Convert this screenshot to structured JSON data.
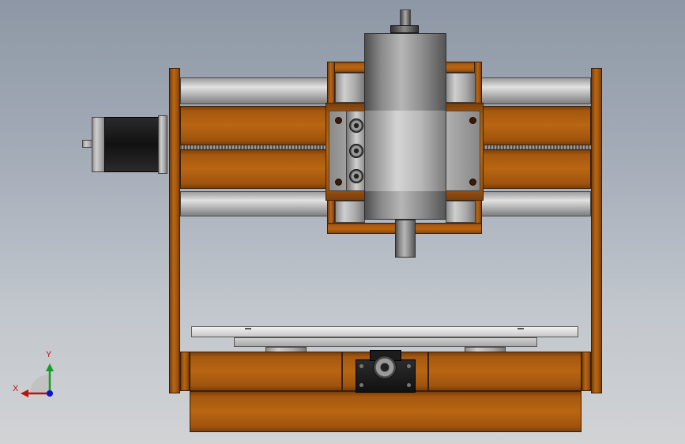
{
  "view": "cad-3d-viewport",
  "model": "cnc-router-front-view",
  "triad": {
    "x_label": "X",
    "y_label": "Y",
    "x_color": "#c01010",
    "y_color": "#10a020",
    "z_color": "#1010d0"
  },
  "colors": {
    "wood": "#b86612",
    "steel": "#c8c8c8",
    "motor_body": "#1c1c1c",
    "background_top": "#8e97a5",
    "background_bottom": "#d1d3d5"
  }
}
